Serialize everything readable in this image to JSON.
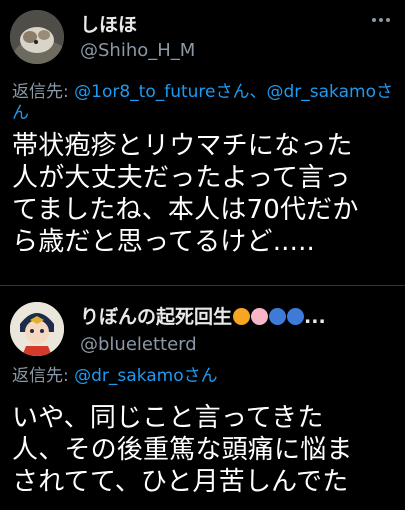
{
  "tweet1": {
    "display_name": "しほほ",
    "handle": "@Shiho_H_M",
    "reply_prefix": "返信先: ",
    "reply_mentions": "@1or8_to_futureさん、@dr_sakamoさん",
    "body": "帯状疱疹とリウマチになった\n人が大丈夫だったよって言っ\nてましたね、本人は70代だか\nら歳だと思ってるけど....."
  },
  "tweet2": {
    "display_name": "りぼんの起死回生",
    "name_suffix": "...",
    "handle": "@blueletterd",
    "reply_prefix": "返信先: ",
    "reply_mentions": "@dr_sakamoさん",
    "body": "いや、同じこと言ってきた\n人、その後重篤な頭痛に悩ま\nされてて、ひと月苦しんでた"
  },
  "colors": {
    "background": "#000000",
    "text": "#e7e9ea",
    "secondary": "#8b98a5",
    "link": "#1d9bf0",
    "divider": "#2f3336"
  }
}
